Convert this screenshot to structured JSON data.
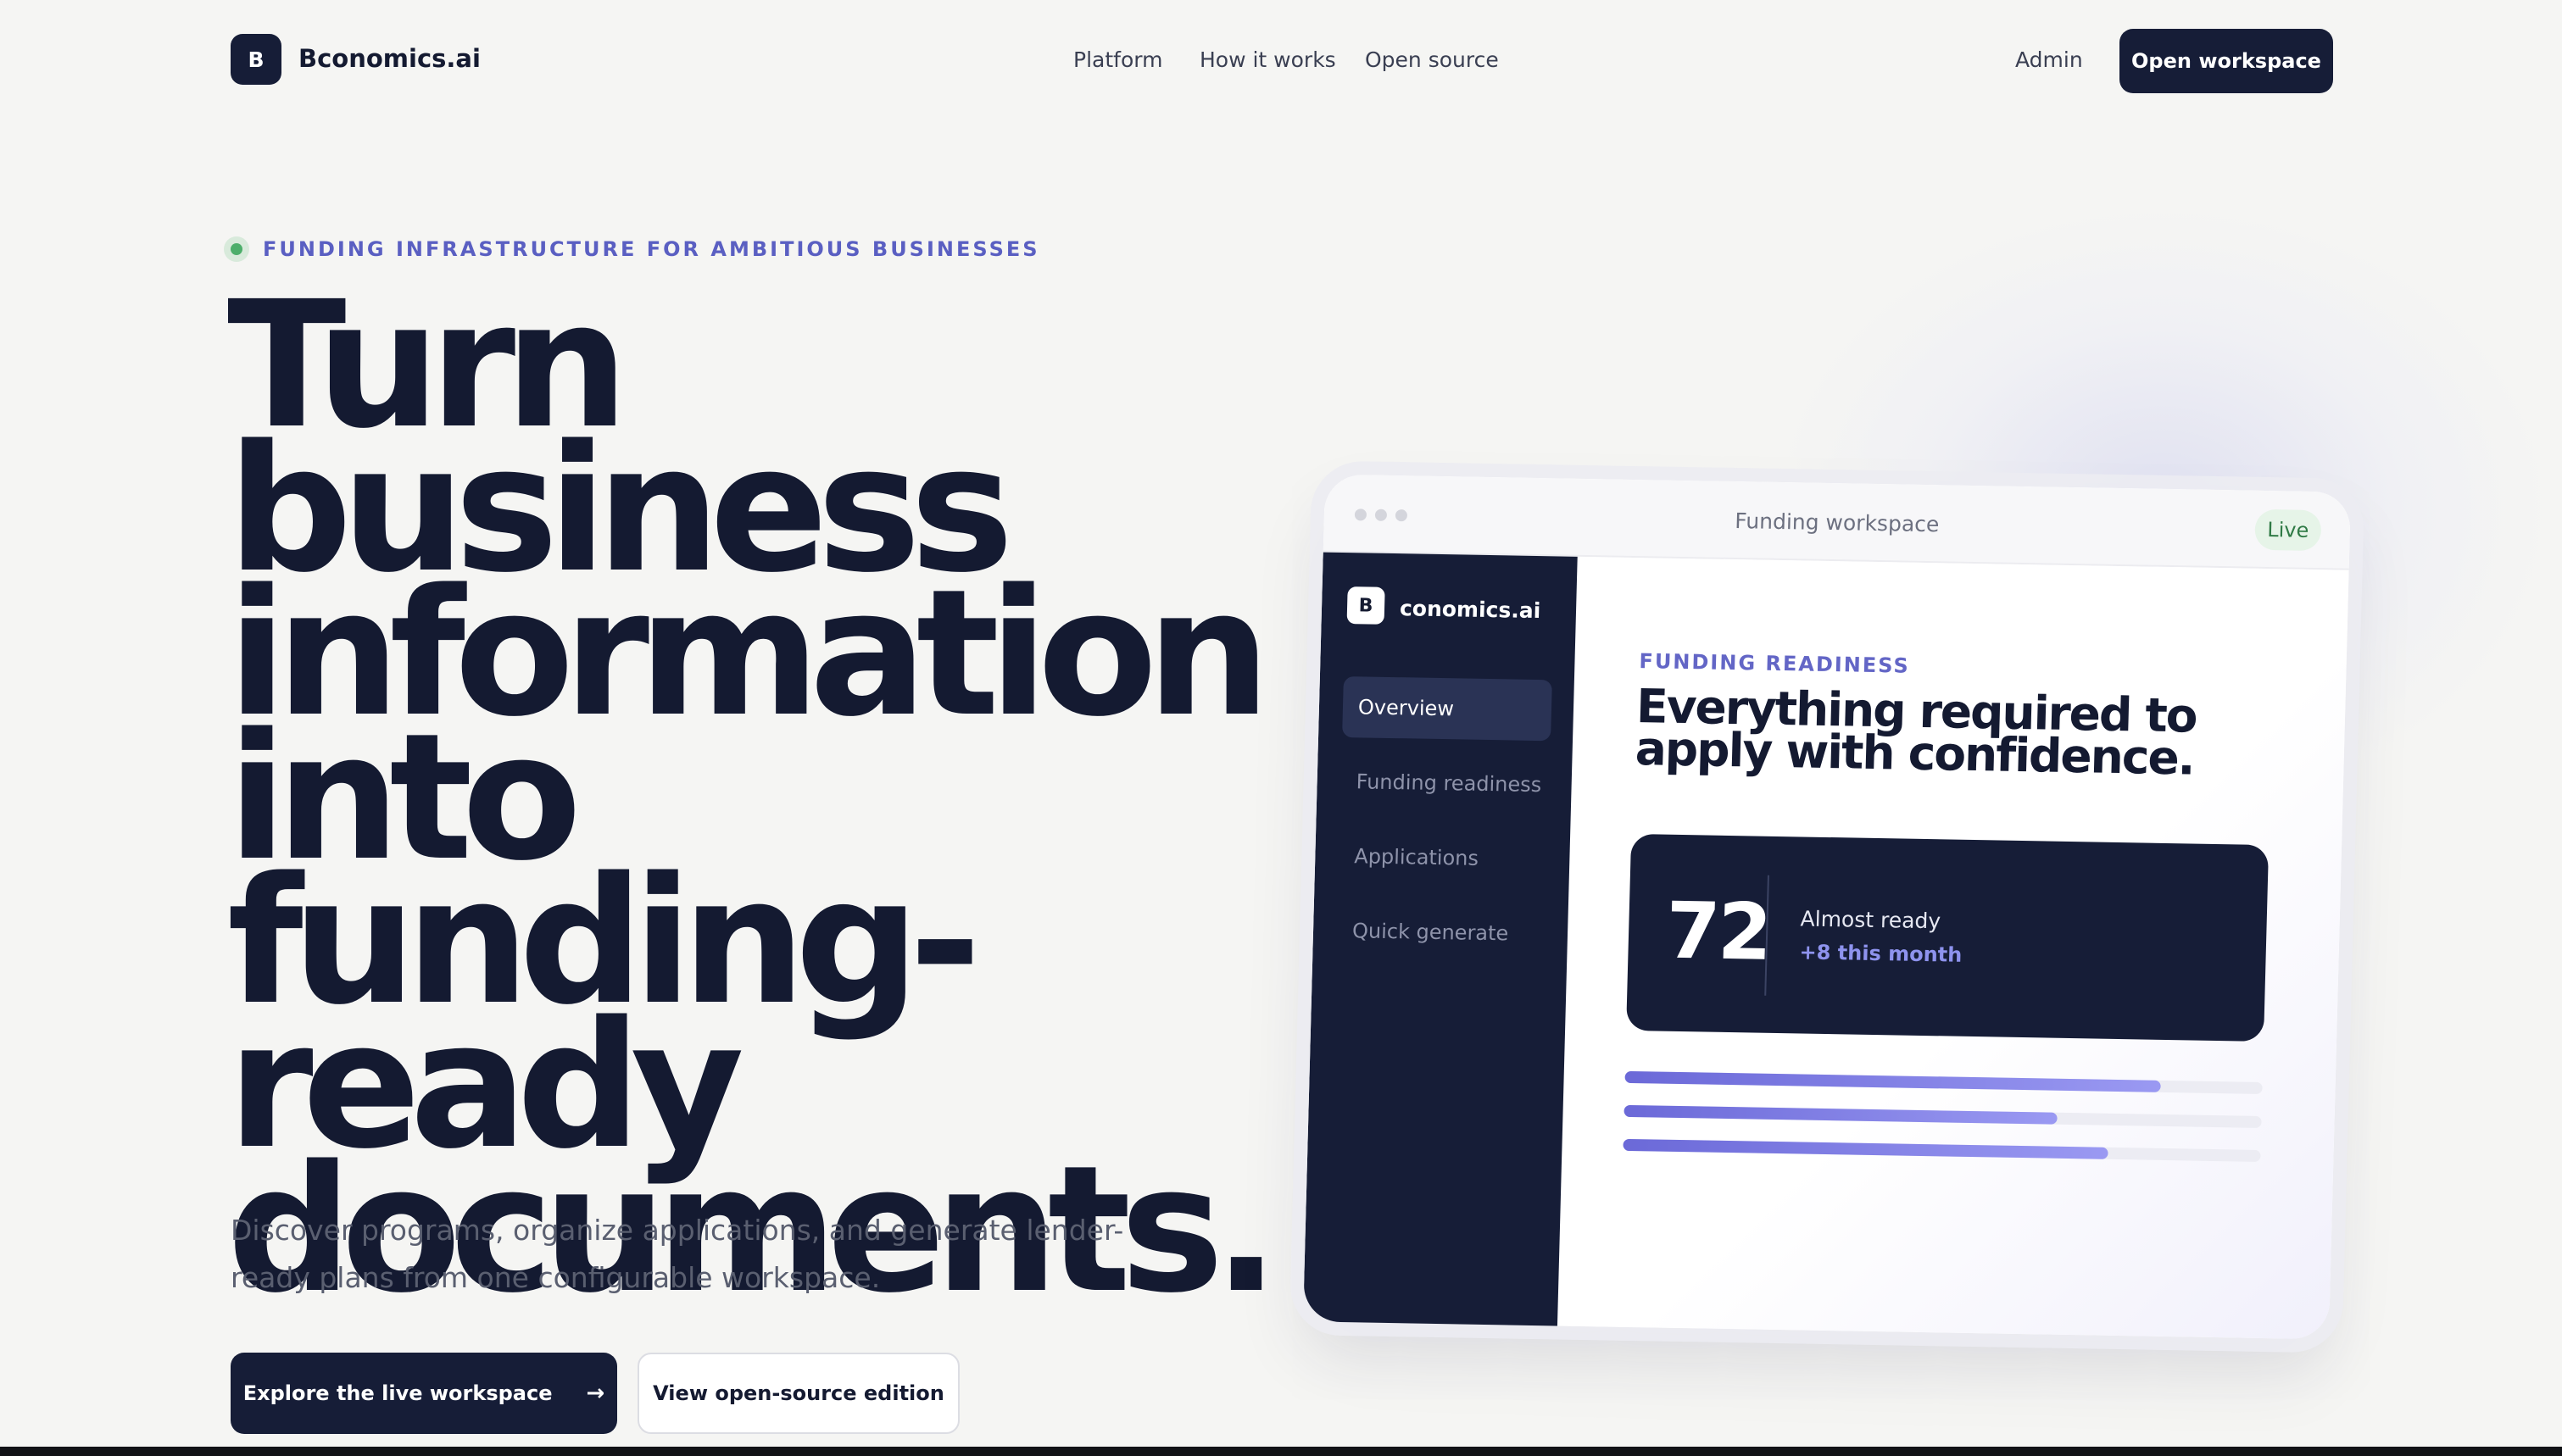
{
  "nav": {
    "logo_letter": "B",
    "brand": "Bconomics.ai",
    "links": [
      "Platform",
      "How it works",
      "Open source"
    ],
    "admin": "Admin",
    "cta": "Open workspace"
  },
  "hero": {
    "eyebrow": "FUNDING INFRASTRUCTURE FOR AMBITIOUS BUSINESSES",
    "headline": "Turn business information into funding-ready documents.",
    "subtitle": "Discover programs, organize applications, and generate lender-ready plans from one configurable workspace.",
    "primary_cta": "Explore the live workspace",
    "primary_cta_icon": "arrow-right-icon",
    "secondary_cta": "View open-source edition"
  },
  "mockup": {
    "window_title": "Funding workspace",
    "status_badge": "Live",
    "logo_letter": "B",
    "brand": "conomics.ai",
    "sidebar_items": [
      "Overview",
      "Funding readiness",
      "Applications",
      "Quick generate"
    ],
    "active_item": "Overview",
    "section_label": "FUNDING READINESS",
    "heading": "Everything required to apply with confidence.",
    "score": "72",
    "score_status": "Almost ready",
    "score_delta": "+8 this month",
    "progress_bars": [
      0.84,
      0.68,
      0.76
    ]
  },
  "colors": {
    "primary_dark": "#161d37",
    "accent_purple": "#6366c6",
    "live_green": "#2f7a45",
    "page_bg": "#f5f5f3"
  }
}
